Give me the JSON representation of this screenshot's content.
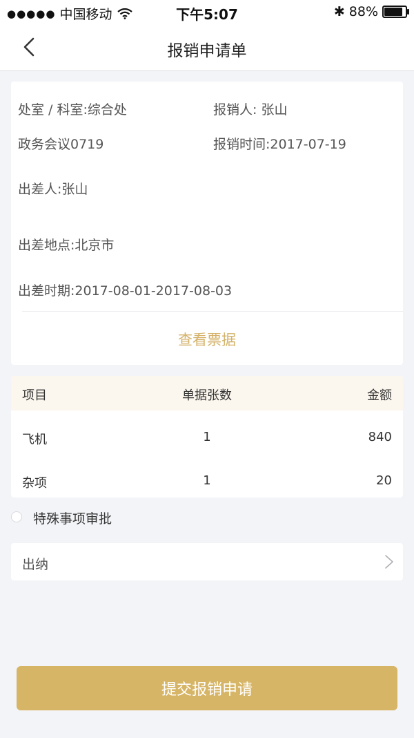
{
  "status_bar": {
    "signal_dots": "●●●●●",
    "carrier": "中国移动",
    "time": "下午5:07",
    "bluetooth": "✱",
    "battery": "88%",
    "battery_level": 0.88
  },
  "nav": {
    "title": "报销申请单"
  },
  "info": {
    "department": "处室 / 科室:综合处",
    "applicant": "报销人: 张山",
    "meeting": "政务会议0719",
    "date": "报销时间:2017-07-19",
    "traveler": "出差人:张山",
    "location": "出差地点:北京市",
    "period": "出差时期:2017-08-01-2017-08-03",
    "view_receipts": "查看票据"
  },
  "table": {
    "headers": [
      "项目",
      "单据张数",
      "金额"
    ],
    "rows": [
      {
        "item": "飞机",
        "count": "1",
        "amount": "840"
      },
      {
        "item": "杂项",
        "count": "1",
        "amount": "20"
      }
    ]
  },
  "special": {
    "label": "特殊事项审批"
  },
  "cashier": {
    "label": "出纳"
  },
  "submit": {
    "label": "提交报销申请"
  },
  "colors": {
    "accent": "#d7b566",
    "link": "#d4b26a",
    "table_header_bg": "#fcf7ee",
    "page_bg": "#f3f4f8"
  }
}
